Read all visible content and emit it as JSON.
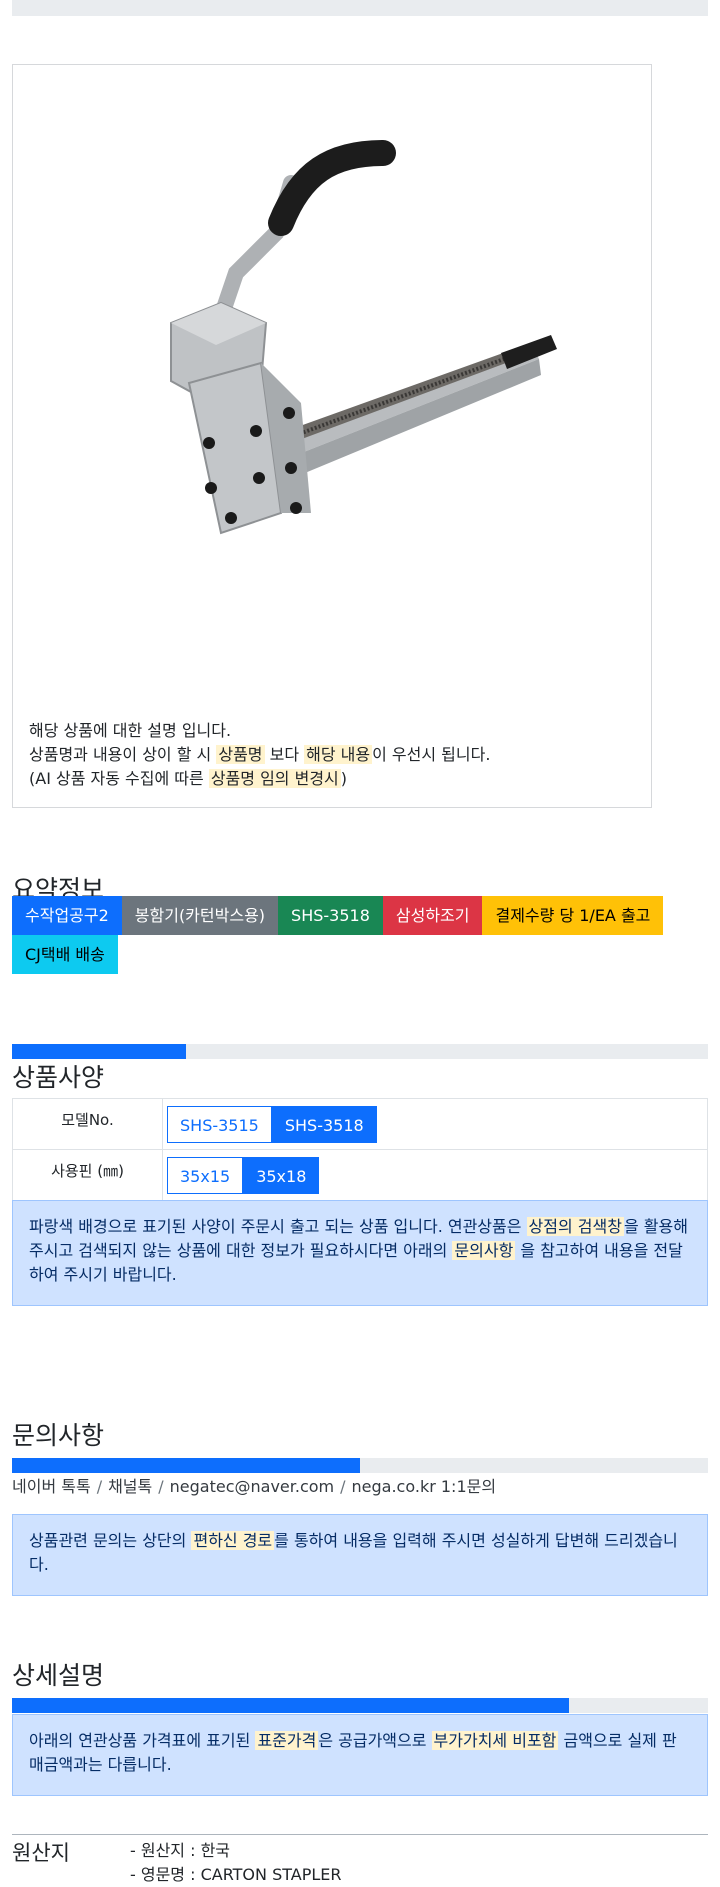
{
  "product": {
    "image_alt": "Carton stapler SHS-3518",
    "desc_line1": "해당 상품에 대한 설명 입니다.",
    "desc_line2_a": "상품명과 내용이 상이 할 시 ",
    "desc_line2_hl1": "상품명",
    "desc_line2_b": " 보다 ",
    "desc_line2_hl2": "해당 내용",
    "desc_line2_c": "이 우선시 됩니다.",
    "desc_line3_a": "(AI 상품 자동 수집에 따른 ",
    "desc_line3_hl": "상품명 임의 변경시",
    "desc_line3_b": ")"
  },
  "summary": {
    "title": "요약정보",
    "badges": [
      {
        "label": "수작업공구2",
        "color": "#0d6efd"
      },
      {
        "label": "봉함기(카턴박스용)",
        "color": "#6c757d"
      },
      {
        "label": "SHS-3518",
        "color": "#198754"
      },
      {
        "label": "삼성하조기",
        "color": "#dc3545"
      },
      {
        "label": "결제수량 당 1/EA 출고",
        "color": "#ffc107"
      },
      {
        "label": "CJ택배 배송",
        "color": "#0dcaf0"
      }
    ]
  },
  "specs": {
    "title": "상품사양",
    "progress": 0.25,
    "rows": [
      {
        "label": "모델No.",
        "options": [
          "SHS-3515",
          "SHS-3518"
        ],
        "selected": "SHS-3518"
      },
      {
        "label": "사용핀 (㎜)",
        "options": [
          "35x15",
          "35x18"
        ],
        "selected": "35x18"
      }
    ],
    "notice_a": "파랑색 배경으로 표기된 사양이 주문시 출고 되는 상품 입니다. 연관상품은 ",
    "notice_hl1": "상점의 검색창",
    "notice_b": "을 활용해 주시고 검색되지 않는 상품에 대한 정보가 필요하시다면 아래의 ",
    "notice_hl2": "문의사항",
    "notice_c": " 을 참고하여 내용을 전달하여 주시기 바랍니다."
  },
  "inquiry": {
    "title": "문의사항",
    "progress": 0.5,
    "contacts": [
      "네이버 톡톡",
      "채널톡",
      "negatec@naver.com",
      "nega.co.kr 1:1문의"
    ],
    "notice_a": "상품관련 문의는 상단의 ",
    "notice_hl": "편하신 경로",
    "notice_b": "를 통하여 내용을 입력해 주시면 성실하게 답변해 드리겠습니다."
  },
  "detail": {
    "title": "상세설명",
    "progress": 0.8,
    "notice_a": "아래의 연관상품 가격표에 표기된 ",
    "notice_hl1": "표준가격",
    "notice_b": "은 공급가액으로 ",
    "notice_hl2": "부가가치세 비포함",
    "notice_c": " 금액으로 실제 판매금액과는 다릅니다."
  },
  "origin": {
    "title": "원산지",
    "items": [
      "- 원산지 : 한국",
      "- 영문명 : CARTON STAPLER"
    ]
  },
  "colors": {
    "accent": "#0d6efd",
    "highlight": "#fff3cd",
    "notice_bg": "#cfe2ff"
  }
}
